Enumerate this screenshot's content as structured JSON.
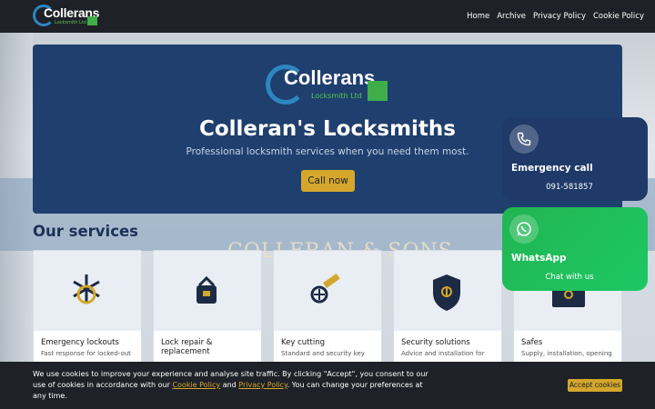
{
  "brand": {
    "name": "Collerans",
    "sub": "Locksmith Ltd"
  },
  "nav": {
    "items": [
      "Home",
      "Archive",
      "Privacy Policy",
      "Cookie Policy"
    ]
  },
  "hero": {
    "title": "Colleran's Locksmiths",
    "subtitle": "Professional locksmith services when you need them most.",
    "cta": "Call now"
  },
  "background_sign": "COLLERAN & SONS",
  "services": {
    "heading": "Our services",
    "items": [
      {
        "title": "Emergency lockouts",
        "desc": "Fast response for locked-out",
        "icon": "emergency-icon"
      },
      {
        "title": "Lock repair & replacement",
        "desc": "",
        "icon": "padlock-icon"
      },
      {
        "title": "Key cutting",
        "desc": "Standard and security key",
        "icon": "key-icon"
      },
      {
        "title": "Security solutions",
        "desc": "Advice and installation for",
        "icon": "shield-icon"
      },
      {
        "title": "Safes",
        "desc": "Supply, installation, opening",
        "icon": "safe-icon"
      }
    ]
  },
  "contact": {
    "call": {
      "title": "Emergency call",
      "number": "091-581857",
      "icon": "phone-icon"
    },
    "whatsapp": {
      "title": "WhatsApp",
      "action": "Chat with us",
      "icon": "whatsapp-icon"
    }
  },
  "cookie": {
    "text_1": "We use cookies to improve your experience and analyse site traffic. By clicking \"Accept\", you consent to our use of cookies in accordance with our ",
    "link_1": "Cookie Policy",
    "text_2": " and ",
    "link_2": "Privacy Policy",
    "text_3": ". You can change your preferences at any time.",
    "accept": "Accept cookies"
  },
  "colors": {
    "nav": "#1e2127",
    "hero": "#1f3f6e",
    "accent": "#d4a72c",
    "whatsapp": "#22b552",
    "heading": "#1c3158"
  }
}
